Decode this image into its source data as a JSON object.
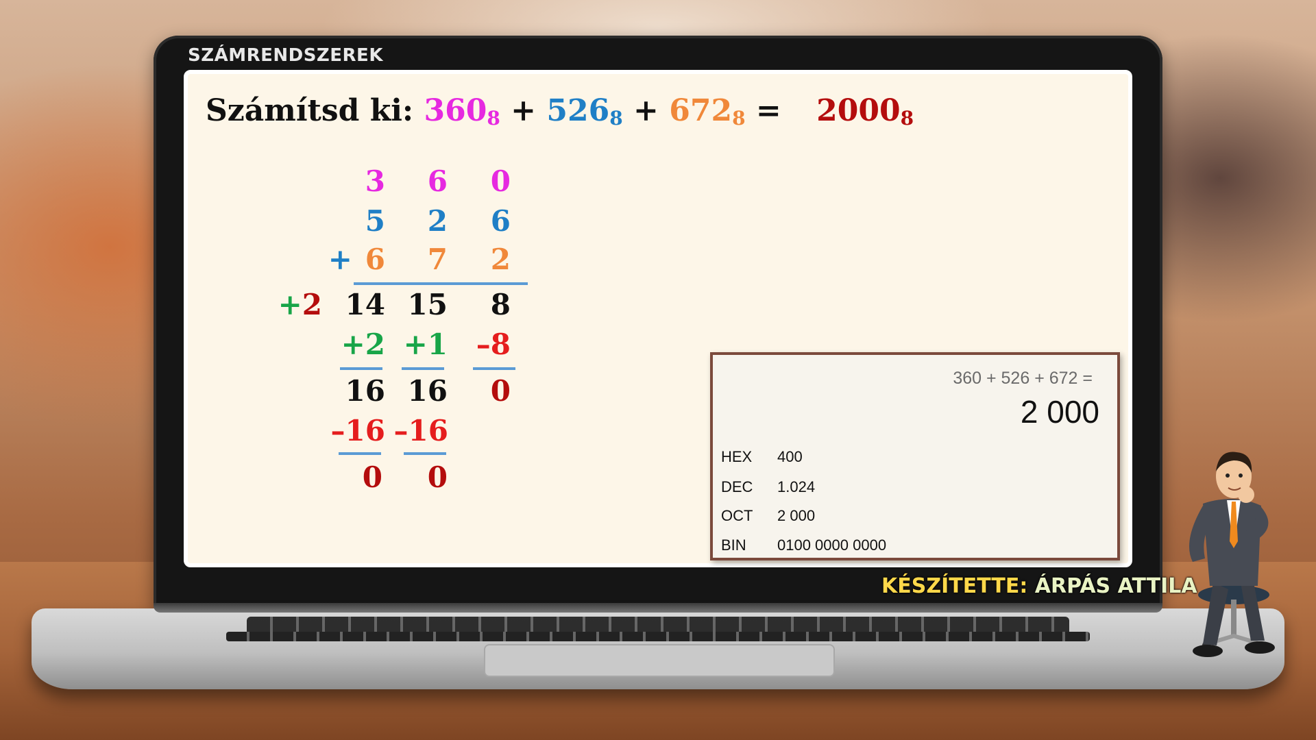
{
  "header": {
    "title": "SZÁMRENDSZEREK"
  },
  "equation": {
    "prefix": "Számítsd ki:",
    "n1": "360",
    "base1": "8",
    "op1": "+",
    "n2": "526",
    "base2": "8",
    "op2": "+",
    "n3": "672",
    "base3": "8",
    "eq": "=",
    "result": "2000",
    "result_base": "8"
  },
  "work": {
    "row1": [
      "3",
      "6",
      "0"
    ],
    "row2": [
      "5",
      "2",
      "6"
    ],
    "row3_plus": "+",
    "row3": [
      "6",
      "7",
      "2"
    ],
    "carry_out": "+2",
    "sums": [
      "14",
      "15",
      "8"
    ],
    "adjust": [
      "+2",
      "+1",
      "–8"
    ],
    "subtotals": [
      "16",
      "16",
      "0"
    ],
    "subtract": [
      "–16",
      "–16"
    ],
    "digits": [
      "0",
      "0"
    ]
  },
  "calculator": {
    "expression": "360 + 526 + 672 =",
    "result": "2 000",
    "rows": [
      {
        "key": "HEX",
        "value": "400"
      },
      {
        "key": "DEC",
        "value": "1.024"
      },
      {
        "key": "OCT",
        "value": "2 000"
      },
      {
        "key": "BIN",
        "value": "0100 0000 0000"
      }
    ]
  },
  "credit": {
    "label": "KÉSZÍTETTE:",
    "name": "ÁRPÁS ATTILA"
  },
  "colors": {
    "magenta": "#e629e0",
    "blue": "#1f7fc6",
    "orange": "#f0883a",
    "dark_red": "#b40d0d",
    "red": "#e51d1d",
    "green": "#18a548"
  }
}
